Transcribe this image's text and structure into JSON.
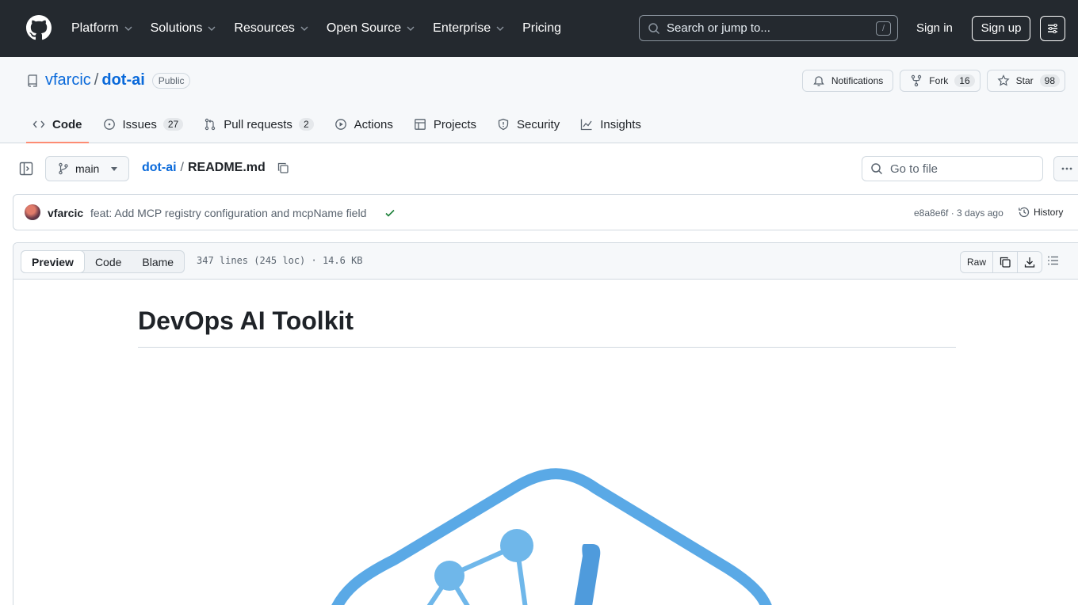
{
  "header": {
    "nav": [
      {
        "label": "Platform",
        "has_menu": true
      },
      {
        "label": "Solutions",
        "has_menu": true
      },
      {
        "label": "Resources",
        "has_menu": true
      },
      {
        "label": "Open Source",
        "has_menu": true
      },
      {
        "label": "Enterprise",
        "has_menu": true
      },
      {
        "label": "Pricing",
        "has_menu": false
      }
    ],
    "search_placeholder": "Search or jump to...",
    "search_shortcut": "/",
    "sign_in": "Sign in",
    "sign_up": "Sign up"
  },
  "repo": {
    "owner": "vfarcic",
    "separator": "/",
    "name": "dot-ai",
    "visibility": "Public",
    "actions": {
      "notifications": "Notifications",
      "fork_label": "Fork",
      "fork_count": "16",
      "star_label": "Star",
      "star_count": "98"
    },
    "tabs": [
      {
        "label": "Code",
        "count": null,
        "icon": "code-icon"
      },
      {
        "label": "Issues",
        "count": "27",
        "icon": "issue-icon"
      },
      {
        "label": "Pull requests",
        "count": "2",
        "icon": "pull-request-icon"
      },
      {
        "label": "Actions",
        "count": null,
        "icon": "play-icon"
      },
      {
        "label": "Projects",
        "count": null,
        "icon": "table-icon"
      },
      {
        "label": "Security",
        "count": null,
        "icon": "shield-icon"
      },
      {
        "label": "Insights",
        "count": null,
        "icon": "graph-icon"
      }
    ]
  },
  "file_nav": {
    "branch": "main",
    "repo_link": "dot-ai",
    "separator": "/",
    "file_name": "README.md",
    "goto_placeholder": "Go to file"
  },
  "commit": {
    "author": "vfarcic",
    "message": "feat: Add MCP registry configuration and mcpName field",
    "sha_age": "e8a8e6f · 3 days ago",
    "history": "History"
  },
  "file_view": {
    "modes": [
      "Preview",
      "Code",
      "Blame"
    ],
    "active_mode": "Preview",
    "info": "347 lines (245 loc) · 14.6 KB",
    "raw": "Raw"
  },
  "readme": {
    "title": "DevOps AI Toolkit"
  },
  "colors": {
    "header_bg": "#24292f",
    "link": "#0969da",
    "active_tab_underline": "#fd8c73",
    "success": "#1a7f37",
    "logo_blue": "#5aa9e6"
  }
}
